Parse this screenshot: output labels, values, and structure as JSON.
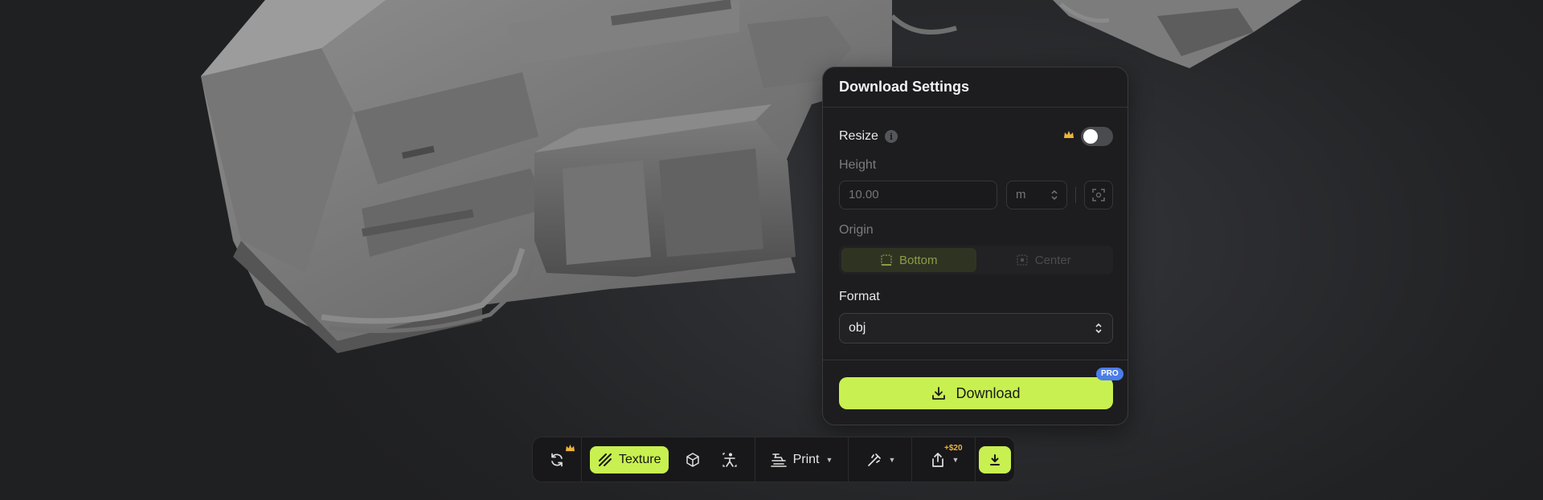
{
  "panel": {
    "title": "Download Settings",
    "resize_label": "Resize",
    "resize_enabled": false,
    "height_label": "Height",
    "height_value": "10.00",
    "unit_value": "m",
    "origin_label": "Origin",
    "origin_options": [
      "Bottom",
      "Center"
    ],
    "origin_selected": "Bottom",
    "format_label": "Format",
    "format_value": "obj",
    "download_label": "Download",
    "pro_badge": "PRO"
  },
  "toolbar": {
    "texture_label": "Texture",
    "print_label": "Print",
    "credit_label": "+$20"
  },
  "colors": {
    "accent": "#c8f050",
    "pro_badge": "#4a7de8",
    "crown": "#f0b43c",
    "panel_bg": "#1d1d1f"
  },
  "icons": {
    "remesh": "refresh-icon",
    "texture": "texture-stripes-icon",
    "wireframe": "cube-outline-icon",
    "rig": "figure-icon",
    "print": "printer-icon",
    "tools": "magic-icon",
    "share": "share-icon",
    "download": "download-icon"
  }
}
